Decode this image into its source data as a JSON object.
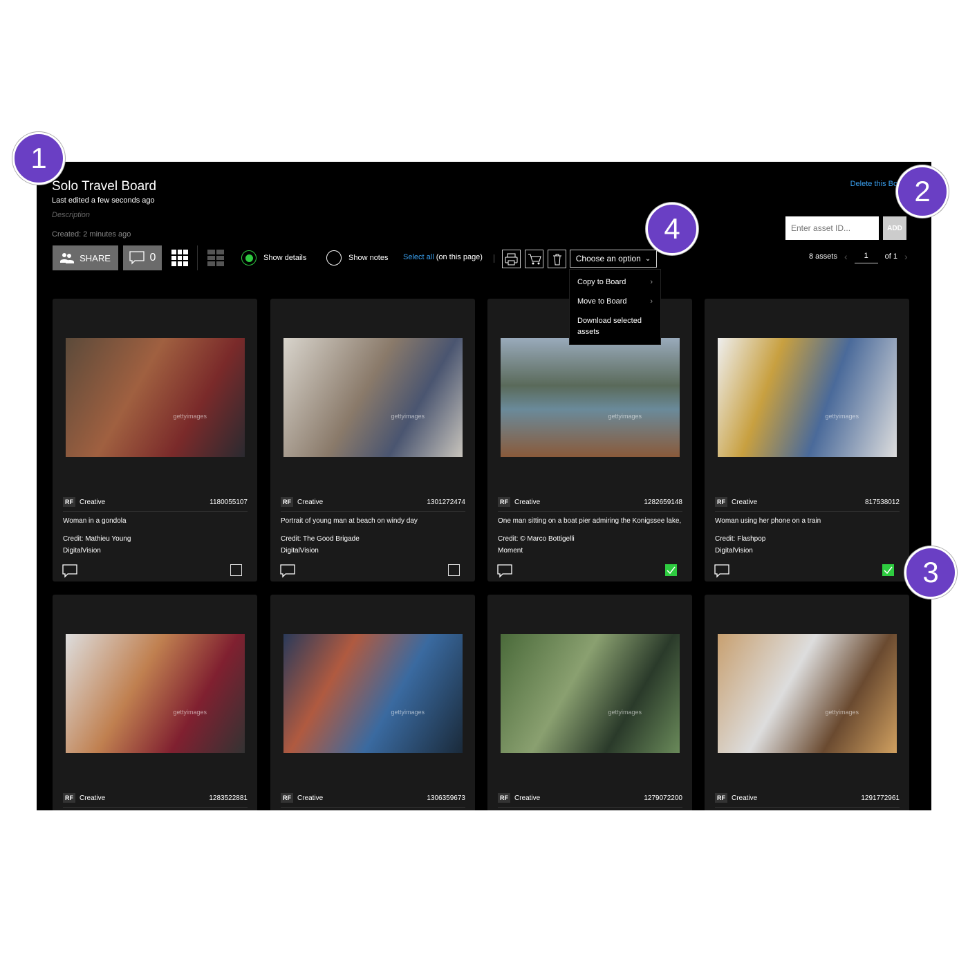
{
  "board": {
    "title": "Solo Travel Board",
    "last_edited": "Last edited a few seconds ago",
    "description_placeholder": "Description",
    "created": "Created: 2 minutes ago",
    "delete_label": "Delete this Board"
  },
  "toolbar": {
    "share_label": "SHARE",
    "comment_count": "0",
    "show_details": "Show details",
    "show_details_on": true,
    "show_notes": "Show notes",
    "select_all": "Select all",
    "select_all_suffix": "(on this page)",
    "choose_option": "Choose an option",
    "menu": [
      "Copy to Board",
      "Move to Board",
      "Download selected assets"
    ]
  },
  "add_asset": {
    "placeholder": "Enter asset ID...",
    "button": "ADD"
  },
  "pager": {
    "count": "8 assets",
    "page": "1",
    "of": "of 1"
  },
  "watermark": "gettyimages",
  "colors": {
    "accent_link": "#3aa0f0",
    "selected_green": "#2ecc40",
    "badge_purple": "#6a3fc4"
  },
  "cards": [
    {
      "license": "RF",
      "type": "Creative",
      "id": "1180055107",
      "title": "Woman in a gondola",
      "credit": "Credit: Mathieu Young",
      "collection": "DigitalVision",
      "selected": false
    },
    {
      "license": "RF",
      "type": "Creative",
      "id": "1301272474",
      "title": "Portrait of young man at beach on windy day",
      "credit": "Credit: The Good Brigade",
      "collection": "DigitalVision",
      "selected": false
    },
    {
      "license": "RF",
      "type": "Creative",
      "id": "1282659148",
      "title": "One man sitting on a boat pier admiring the Konigssee lake,",
      "credit": "Credit: © Marco Bottigelli",
      "collection": "Moment",
      "selected": true
    },
    {
      "license": "RF",
      "type": "Creative",
      "id": "817538012",
      "title": "Woman using her phone on a train",
      "credit": "Credit: Flashpop",
      "collection": "DigitalVision",
      "selected": true
    },
    {
      "license": "RF",
      "type": "Creative",
      "id": "1283522881"
    },
    {
      "license": "RF",
      "type": "Creative",
      "id": "1306359673"
    },
    {
      "license": "RF",
      "type": "Creative",
      "id": "1279072200"
    },
    {
      "license": "RF",
      "type": "Creative",
      "id": "1291772961"
    }
  ],
  "badges": [
    "1",
    "2",
    "3",
    "4"
  ]
}
